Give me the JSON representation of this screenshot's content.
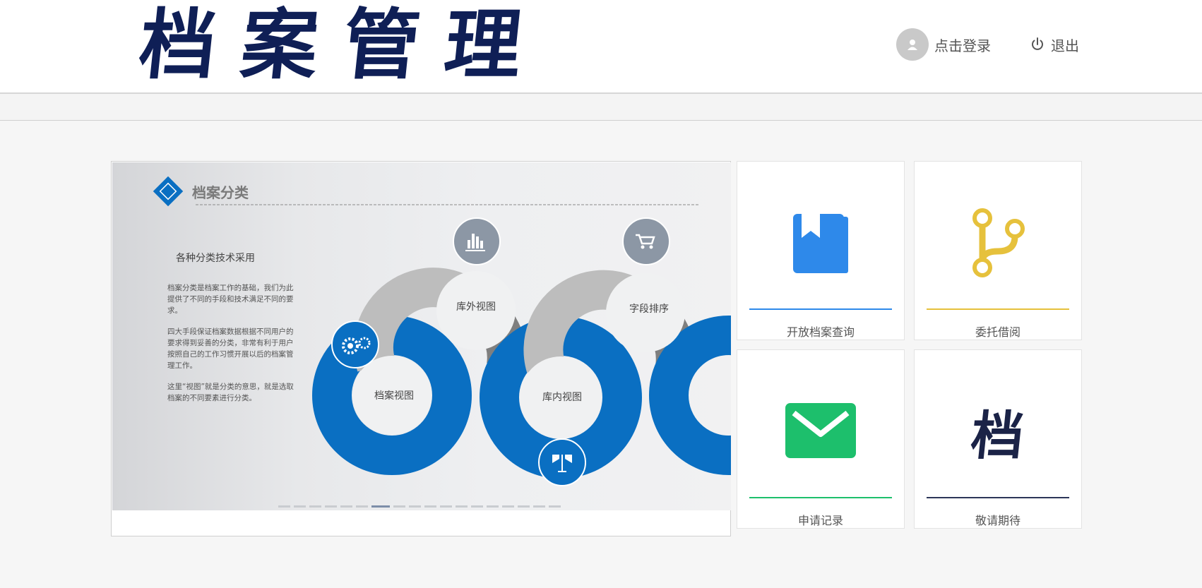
{
  "header": {
    "logo_text": "档案管理",
    "login_label": "点击登录",
    "logout_label": "退出"
  },
  "slide": {
    "title": "档案分类",
    "subtitle": "各种分类技术采用",
    "paragraphs": [
      "档案分类是档案工作的基础，我们为此提供了不同的手段和技术满足不同的要求。",
      "四大手段保证档案数据根据不同用户的要求得到妥善的分类，非常有利于用户按照自己的工作习惯开展以后的档案管理工作。",
      "这里“视图”就是分类的意思，就是选取档案的不同要素进行分类。"
    ],
    "ring_labels": [
      "档案视图",
      "库外视图",
      "库内视图",
      "字段排序"
    ],
    "icons": [
      "gears-icon",
      "bar-chart-icon",
      "cart-icon",
      "antenna-icon"
    ],
    "dots_count": 18,
    "active_dot": 6
  },
  "cards": [
    {
      "label": "开放档案查询",
      "icon": "book-icon",
      "color": "#2e89ea"
    },
    {
      "label": "委托借阅",
      "icon": "branch-icon",
      "color": "#e6c13c"
    },
    {
      "label": "申请记录",
      "icon": "envelope-icon",
      "color": "#1dbf6c"
    },
    {
      "label": "敬请期待",
      "icon": "dang-character-icon",
      "icon_text": "档",
      "color": "#2c3658"
    }
  ],
  "colors": {
    "brand_navy": "#0f1f56",
    "slide_blue": "#0a6fc2",
    "ring_grey_light": "#bdbdbd",
    "ring_grey_dark": "#7f7f7f"
  }
}
